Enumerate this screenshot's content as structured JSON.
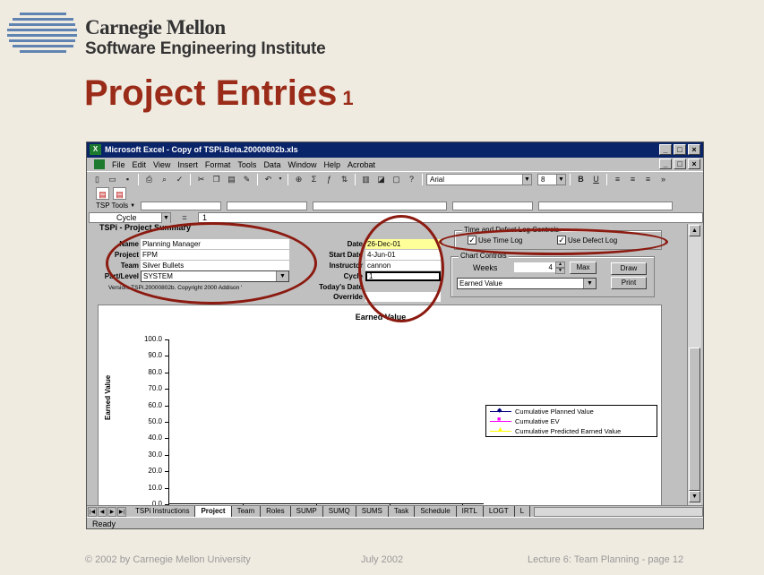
{
  "header": {
    "org_line1": "Carnegie Mellon",
    "org_line2": "Software Engineering Institute",
    "title": "Project Entries",
    "title_number": "1",
    "logo_icon": "sei-stripes-logo"
  },
  "excel": {
    "window_title": "Microsoft Excel - Copy of TSPi.Beta.20000802b.xls",
    "menu": [
      "File",
      "Edit",
      "View",
      "Insert",
      "Format",
      "Tools",
      "Data",
      "Window",
      "Help",
      "Acrobat"
    ],
    "font_name": "Arial",
    "font_size": "8",
    "bold_label": "B",
    "underline_label": "U",
    "tsp_tools_label": "TSP Tools",
    "name_box": "Cycle",
    "formula_eq": "=",
    "formula_value": "1",
    "status": "Ready"
  },
  "form": {
    "sheet_title": "TSPi  - Project Summary",
    "labels": {
      "name": "Name",
      "project": "Project",
      "team": "Team",
      "part_level": "Part/Level",
      "date": "Date",
      "start_date": "Start Date",
      "instructor": "Instructor",
      "cycle": "Cycle",
      "todays_date": "Today's Date",
      "override": "Override"
    },
    "values": {
      "name": "Planning Manager",
      "project": "FPM",
      "team": "Silver Bullets",
      "part_level": "SYSTEM",
      "date": "26-Dec-01",
      "start_date": "4-Jun-01",
      "instructor": "cannon",
      "cycle": "1"
    },
    "version": "Version:  TSPi.20000802b. Copyright 2000  Addison '"
  },
  "log_controls": {
    "title": "Time and Defect Log Controls",
    "use_time_log": "Use Time Log",
    "use_defect_log": "Use Defect Log",
    "time_checked": true,
    "defect_checked": true
  },
  "chart_controls": {
    "title": "Chart Controls",
    "weeks_label": "Weeks",
    "weeks_value": "4",
    "max_button": "Max",
    "draw_button": "Draw",
    "print_button": "Print",
    "chart_select": "Earned Value"
  },
  "chart_data": {
    "type": "line",
    "title": "Earned Value",
    "xlabel": "",
    "ylabel": "Earned Value",
    "ylim": [
      0,
      100
    ],
    "y_ticks": [
      "100.0",
      "90.0",
      "80.0",
      "70.0",
      "60.0",
      "50.0",
      "40.0",
      "30.0",
      "20.0",
      "10.0",
      "0.0"
    ],
    "x_tick_count": 4,
    "series": [
      {
        "name": "Cumulative Planned Value",
        "values": [],
        "color": "#000080"
      },
      {
        "name": "Cumulative EV",
        "values": [],
        "color": "#ff00ff"
      },
      {
        "name": "Cumulative Predicted Earned Value",
        "values": [],
        "color": "#ffff00"
      }
    ],
    "legend_position": "right"
  },
  "tabs": [
    "TSPi Instructions",
    "Project",
    "Team",
    "Roles",
    "SUMP",
    "SUMQ",
    "SUMS",
    "Task",
    "Schedule",
    "IRTL",
    "LOGT",
    "L"
  ],
  "active_tab": "Project",
  "footer": {
    "copyright": "© 2002 by Carnegie Mellon University",
    "date": "July 2002",
    "lecture": "Lecture 6: Team Planning - page 12"
  },
  "colors": {
    "title_red": "#9a2b18",
    "excel_titlebar": "#0a246a",
    "annotation": "#8b1a10"
  }
}
